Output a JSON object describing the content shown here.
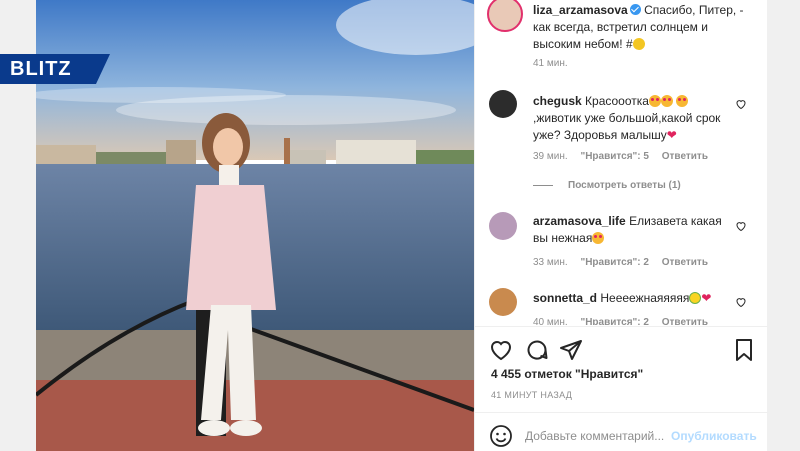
{
  "brand": {
    "logo_text": "BLITZ"
  },
  "post": {
    "author": "liza_arzamasova",
    "caption": "Спасибо, Питер, - как всегда, встретил солнцем и высоким небом! #",
    "caption_time": "41 мин."
  },
  "comments": [
    {
      "user": "chegusk",
      "text_a": "Красооотка",
      "text_b": ",животик уже большой,какой срок уже? Здоровья малышу",
      "time": "39 мин.",
      "likes": "\"Нравится\": 5",
      "reply": "Ответить",
      "view_replies": "Посмотреть ответы (1)"
    },
    {
      "user": "arzamasova_life",
      "text": "Елизавета какая вы нежная",
      "time": "33 мин.",
      "likes": "\"Нравится\": 2",
      "reply": "Ответить"
    },
    {
      "user": "sonnetta_d",
      "text": "Неееежнаяяяяя",
      "time": "40 мин.",
      "likes": "\"Нравится\": 2",
      "reply": "Ответить"
    }
  ],
  "actions": {
    "likes_count": "4 455 отметок \"Нравится\"",
    "post_time": "41 МИНУТ НАЗАД",
    "comment_placeholder": "Добавьте комментарий...",
    "publish": "Опубликовать"
  },
  "icons": [
    "heart-icon",
    "comment-icon",
    "share-icon",
    "bookmark-icon",
    "smile-icon",
    "verified-icon"
  ]
}
